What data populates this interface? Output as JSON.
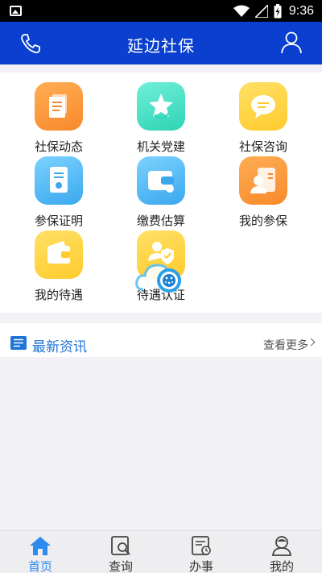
{
  "status_bar": {
    "time": "9:36",
    "icons": [
      "image-icon",
      "wifi-icon",
      "signal-icon",
      "battery-charging-icon"
    ]
  },
  "header": {
    "title": "延边社保",
    "left_icon": "phone-icon",
    "right_icon": "user-icon",
    "background": "#0a3fcf"
  },
  "grid": {
    "items": [
      {
        "label": "社保动态",
        "icon": "document-stack-icon",
        "color": "orange"
      },
      {
        "label": "机关党建",
        "icon": "star-ribbon-icon",
        "color": "teal"
      },
      {
        "label": "社保咨询",
        "icon": "chat-bubble-icon",
        "color": "yellow"
      },
      {
        "label": "参保证明",
        "icon": "certificate-icon",
        "color": "blue"
      },
      {
        "label": "缴费估算",
        "icon": "wallet-card-icon",
        "color": "blue"
      },
      {
        "label": "我的参保",
        "icon": "id-card-icon",
        "color": "orange"
      },
      {
        "label": "我的待遇",
        "icon": "wallet-icon",
        "color": "yellow"
      },
      {
        "label": "待遇认证",
        "icon": "user-shield-icon",
        "color": "yellow"
      }
    ]
  },
  "news": {
    "title": "最新资讯",
    "more_label": "查看更多",
    "accent": "#1e74d7"
  },
  "tabbar": {
    "tabs": [
      {
        "label": "首页",
        "icon": "home-icon",
        "active": true
      },
      {
        "label": "查询",
        "icon": "search-doc-icon",
        "active": false
      },
      {
        "label": "办事",
        "icon": "task-clock-icon",
        "active": false
      },
      {
        "label": "我的",
        "icon": "profile-icon",
        "active": false
      }
    ],
    "active_color": "#2d8bf0"
  }
}
